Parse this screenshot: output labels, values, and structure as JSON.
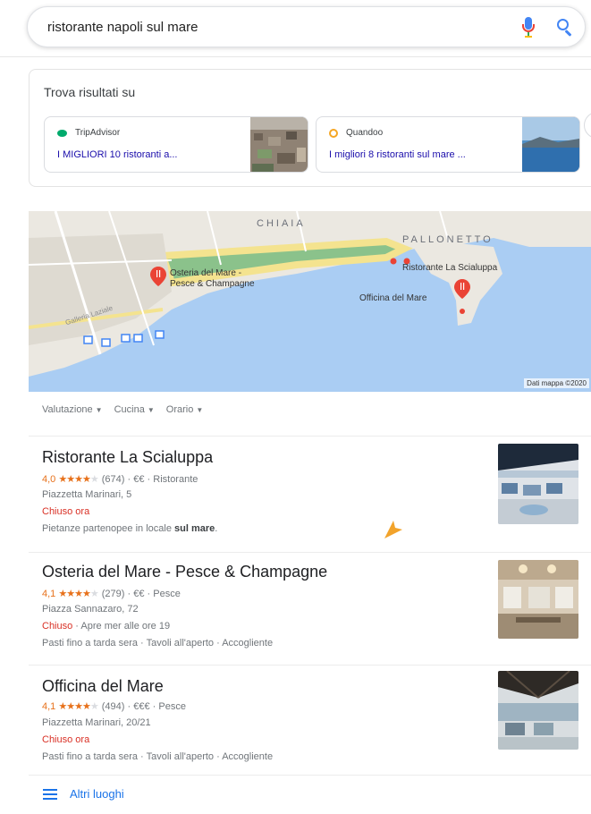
{
  "search": {
    "query": "ristorante napoli sul mare",
    "mic_icon": "microphone-icon",
    "search_icon": "search-icon"
  },
  "trova": {
    "heading": "Trova risultati su",
    "cards": [
      {
        "source": "TripAdvisor",
        "title": "I MIGLIORI 10 ristoranti a..."
      },
      {
        "source": "Quandoo",
        "title": "I migliori 8 ristoranti sul mare ..."
      }
    ]
  },
  "map": {
    "labels": {
      "chiaia": "CHIAIA",
      "pallonetto": "PALLONETTO",
      "galleria": "Galleria Laziale",
      "osteria_line1": "Osteria del Mare -",
      "osteria_line2": "Pesce & Champagne",
      "scialuppa": "Ristorante La Scialuppa",
      "officina": "Officina del Mare"
    },
    "copyright": "Dati mappa ©2020"
  },
  "filters": [
    {
      "label": "Valutazione"
    },
    {
      "label": "Cucina"
    },
    {
      "label": "Orario"
    }
  ],
  "places": [
    {
      "name": "Ristorante La Scialuppa",
      "rating": "4,0",
      "stars": 4,
      "reviews": "(674)",
      "price": "€€",
      "category": "Ristorante",
      "address": "Piazzetta Marinari, 5",
      "status": "Chiuso ora",
      "status_extra": "",
      "description_pre": "Pietanze partenopee in locale ",
      "description_bold": "sul mare",
      "description_post": "."
    },
    {
      "name": "Osteria del Mare - Pesce & Champagne",
      "rating": "4,1",
      "stars": 4,
      "reviews": "(279)",
      "price": "€€",
      "category": "Pesce",
      "address": "Piazza Sannazaro, 72",
      "status": "Chiuso",
      "status_extra": " · Apre mer alle ore 19",
      "description_pre": "Pasti fino a tarda sera · Tavoli all'aperto · Accogliente",
      "description_bold": "",
      "description_post": ""
    },
    {
      "name": "Officina del Mare",
      "rating": "4,1",
      "stars": 4,
      "reviews": "(494)",
      "price": "€€€",
      "category": "Pesce",
      "address": "Piazzetta Marinari, 20/21",
      "status": "Chiuso ora",
      "status_extra": "",
      "description_pre": "Pasti fino a tarda sera · Tavoli all'aperto · Accogliente",
      "description_bold": "",
      "description_post": ""
    }
  ],
  "more_places": "Altri luoghi",
  "colors": {
    "link": "#1a0dab",
    "accent_blue": "#1a73e8",
    "star": "#e7711b",
    "closed": "#d93025",
    "pin": "#ea4335"
  }
}
